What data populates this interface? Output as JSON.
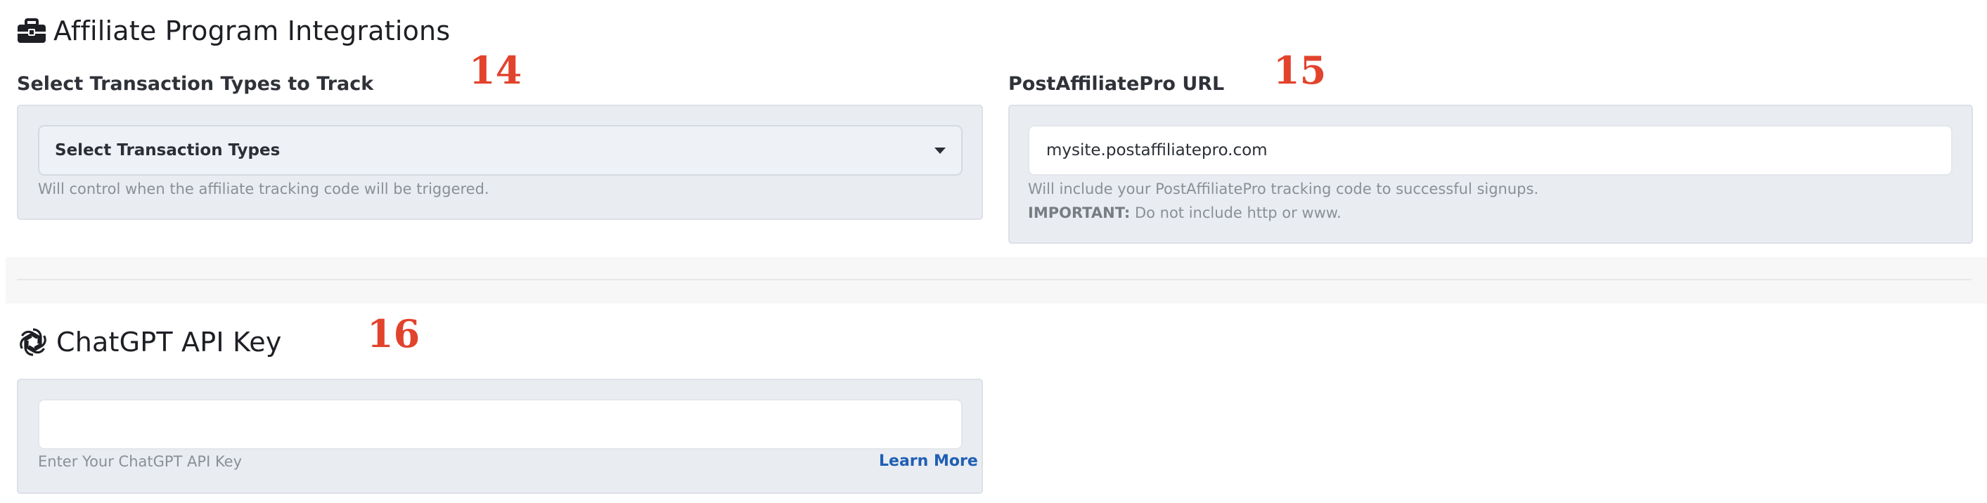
{
  "affiliate": {
    "title": "Affiliate Program Integrations",
    "title_icon": "briefcase-icon",
    "transaction": {
      "label": "Select Transaction Types to Track",
      "select_value": "Select Transaction Types",
      "help": "Will control when the affiliate tracking code will be triggered."
    },
    "pap": {
      "label": "PostAffiliatePro URL",
      "input_value": "mysite.postaffiliatepro.com",
      "help": "Will include your PostAffiliatePro tracking code to successful signups.",
      "important_label": "IMPORTANT:",
      "important_text": " Do not include http or www."
    }
  },
  "chatgpt": {
    "title": "ChatGPT API Key",
    "title_icon": "openai-icon",
    "input_value": "",
    "help": "Enter Your ChatGPT API Key",
    "learn_more": "Learn More"
  },
  "annotations": {
    "a14": "14",
    "a15": "15",
    "a16": "16"
  },
  "colors": {
    "accent_link": "#1f5fb4",
    "annotation": "#e2432d",
    "panel_bg": "#e9ecf1"
  }
}
